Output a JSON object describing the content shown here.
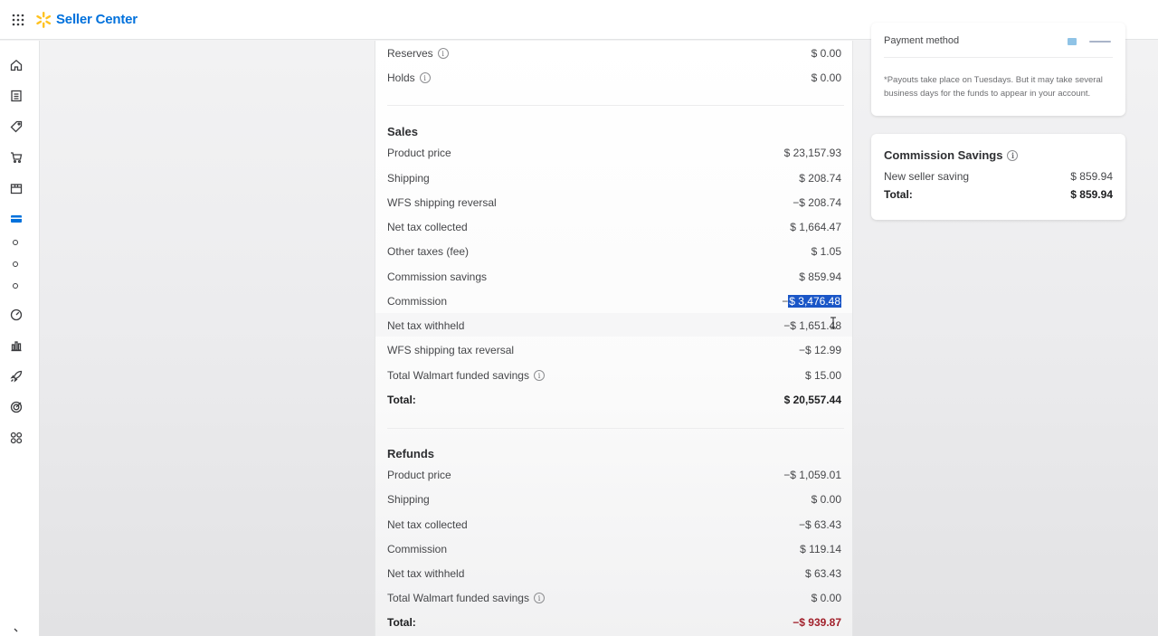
{
  "app": {
    "title": "Seller Center",
    "brand_color": "#0071dc",
    "spark_color": "#ffc220"
  },
  "nav": {
    "icons": [
      "home-icon",
      "orders-icon",
      "tag-icon",
      "cart-icon",
      "package-icon",
      "payments-icon",
      "gauge-icon",
      "analytics-icon",
      "rocket-icon",
      "target-icon",
      "apps-icon"
    ]
  },
  "balance": {
    "reserves_label": "Reserves",
    "reserves_value": "$ 0.00",
    "holds_label": "Holds",
    "holds_value": "$ 0.00"
  },
  "sales": {
    "title": "Sales",
    "rows": [
      {
        "label": "Product price",
        "value": "$ 23,157.93"
      },
      {
        "label": "Shipping",
        "value": "$ 208.74"
      },
      {
        "label": "WFS shipping reversal",
        "value": "−$ 208.74"
      },
      {
        "label": "Net tax collected",
        "value": "$ 1,664.47"
      },
      {
        "label": "Other taxes (fee)",
        "value": "$ 1.05"
      },
      {
        "label": "Commission savings",
        "value": "$ 859.94"
      },
      {
        "label": "Commission",
        "value_prefix": "−",
        "value": "$ 3,476.48"
      },
      {
        "label": "Net tax withheld",
        "value": "−$ 1,651.48"
      },
      {
        "label": "WFS shipping tax reversal",
        "value": "−$ 12.99"
      },
      {
        "label": "Total Walmart funded savings",
        "value": "$ 15.00"
      }
    ],
    "total_label": "Total:",
    "total_value": "$ 20,557.44"
  },
  "refunds": {
    "title": "Refunds",
    "rows": [
      {
        "label": "Product price",
        "value": "−$ 1,059.01"
      },
      {
        "label": "Shipping",
        "value": "$ 0.00"
      },
      {
        "label": "Net tax collected",
        "value": "−$ 63.43"
      },
      {
        "label": "Commission",
        "value": "$ 119.14"
      },
      {
        "label": "Net tax withheld",
        "value": "$ 63.43"
      },
      {
        "label": "Total Walmart funded savings",
        "value": "$ 0.00"
      }
    ],
    "total_label": "Total:",
    "total_value": "−$ 939.87"
  },
  "payment_panel": {
    "label": "Payment method",
    "note": "*Payouts take place on Tuesdays. But it may take several business days for the funds to appear in your account."
  },
  "commission_panel": {
    "title": "Commission Savings",
    "row_label": "New seller saving",
    "row_value": "$ 859.94",
    "total_label": "Total:",
    "total_value": "$ 859.94"
  },
  "info_glyph": "i"
}
